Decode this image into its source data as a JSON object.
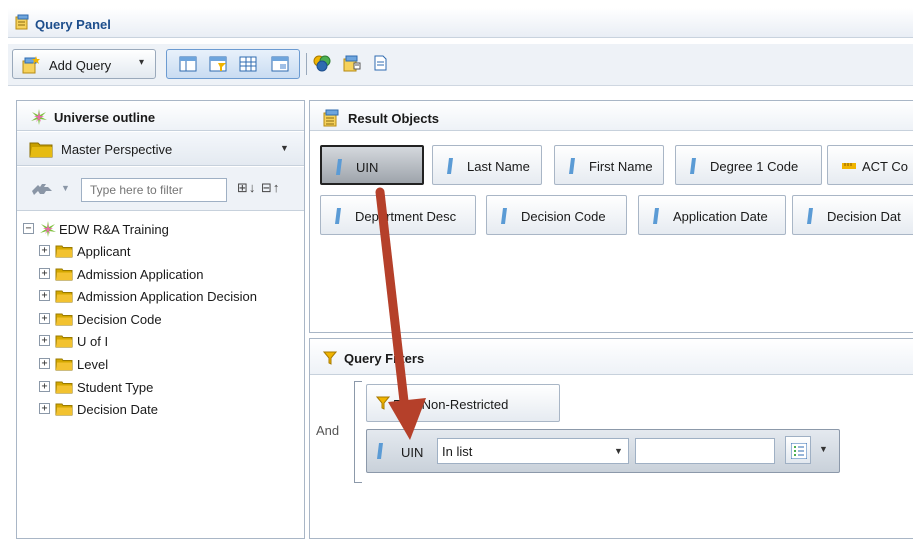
{
  "window": {
    "title": "Query Panel"
  },
  "toolbar": {
    "add_query_label": "Add Query",
    "add_query_caret": "▾"
  },
  "universe_outline": {
    "title": "Universe outline",
    "perspective": "Master Perspective",
    "filter_placeholder": "Type here to filter",
    "expand_collapse": "⊞↓ ⊟↑",
    "root_label": "EDW R&A Training",
    "items": [
      {
        "label": "Applicant"
      },
      {
        "label": "Admission Application"
      },
      {
        "label": "Admission Application Decision"
      },
      {
        "label": "Decision Code"
      },
      {
        "label": "U of I"
      },
      {
        "label": "Level"
      },
      {
        "label": "Student Type"
      },
      {
        "label": "Decision Date"
      }
    ]
  },
  "result_objects": {
    "title": "Result Objects",
    "objects": [
      {
        "label": "UIN",
        "kind": "dimension",
        "selected": true
      },
      {
        "label": "Last Name",
        "kind": "dimension"
      },
      {
        "label": "First Name",
        "kind": "dimension"
      },
      {
        "label": "Degree 1 Code",
        "kind": "dimension"
      },
      {
        "label": "ACT Co",
        "kind": "measure"
      },
      {
        "label": "Department Desc",
        "kind": "dimension"
      },
      {
        "label": "Decision Code",
        "kind": "dimension"
      },
      {
        "label": "Application Date",
        "kind": "dimension"
      },
      {
        "label": "Decision Dat",
        "kind": "dimension"
      }
    ]
  },
  "query_filters": {
    "title": "Query Filters",
    "operator_group": "And",
    "predefined_filter": "RPA Non-Restricted",
    "filter": {
      "object": "UIN",
      "operator": "In list",
      "value": ""
    }
  },
  "colors": {
    "title_blue": "#1d4e8c",
    "annotation_arrow": "#b5402a",
    "folder_yellow": "#f2c230",
    "dimension_blue": "#5b9bd5"
  }
}
